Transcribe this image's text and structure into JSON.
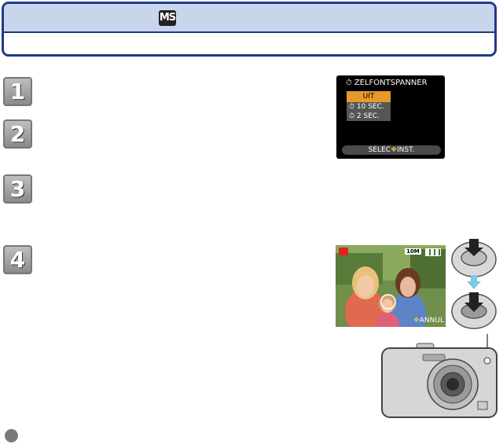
{
  "header": {
    "mode_badge": "MS"
  },
  "steps": [
    "1",
    "2",
    "3",
    "4"
  ],
  "lcd_menu": {
    "title": "ZELFONTSPANNER",
    "options": [
      "UIT",
      "10 SEC.",
      "2 SEC."
    ],
    "selected_index": 0,
    "footer": "SELEC",
    "footer_action": "INST."
  },
  "photo_screen": {
    "resolution_badge": "10M",
    "annul_label": "ANNUL"
  },
  "colors": {
    "header_border": "#1f3a8a",
    "header_fill": "#c9d5ea",
    "menu_highlight": "#e59a2a",
    "arrow": "#7ec8e3"
  },
  "icons": [
    "ms-mode-icon",
    "self-timer-icon",
    "shutter-press-icon",
    "down-arrow-icon",
    "camera-icon",
    "note-icon"
  ]
}
